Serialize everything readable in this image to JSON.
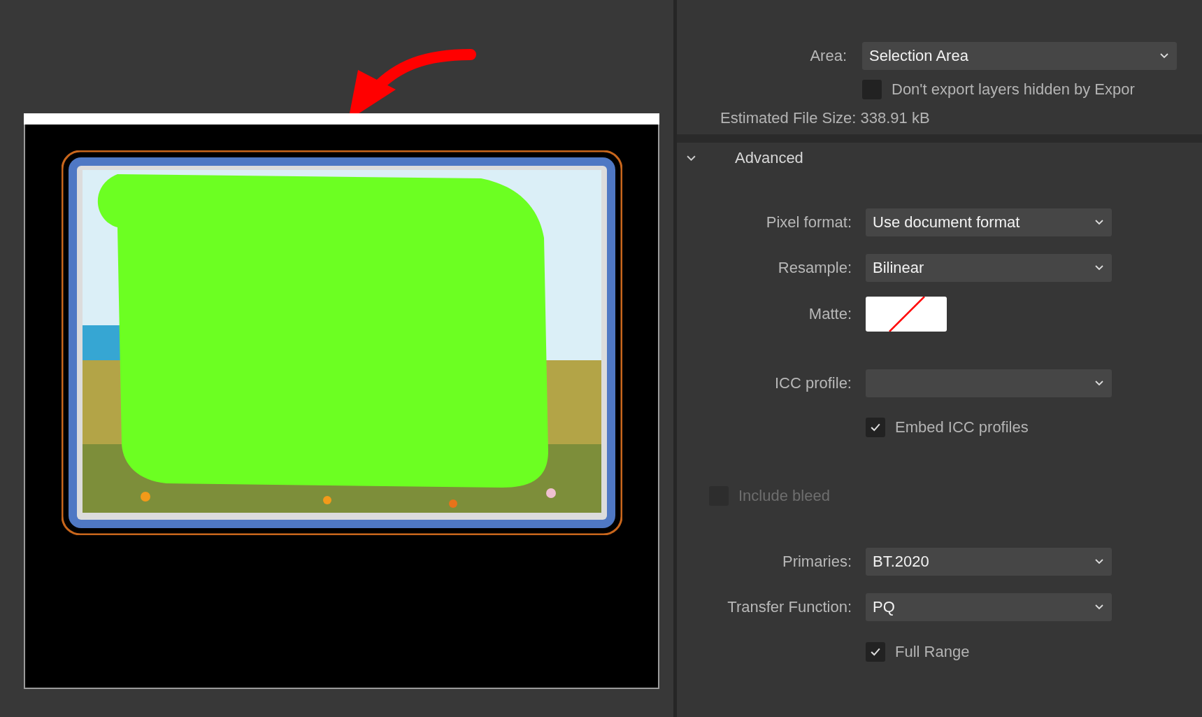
{
  "area": {
    "label": "Area:",
    "value": "Selection Area"
  },
  "hidden_layers": {
    "label": "Don't export layers hidden by Expor",
    "checked": false
  },
  "estimated_size": "Estimated File Size: 338.91 kB",
  "advanced": {
    "title": "Advanced",
    "expanded": true,
    "fields": [
      {
        "kind": "dropdown",
        "label": "Pixel format:",
        "value": "Use document format"
      },
      {
        "kind": "dropdown",
        "label": "Resample:",
        "value": "Bilinear"
      },
      {
        "kind": "swatch",
        "label": "Matte:"
      },
      {
        "kind": "dropdown",
        "label": "ICC profile:"
      },
      {
        "kind": "checkbox",
        "label": "Embed ICC profiles",
        "checked": true,
        "disabled": false
      },
      {
        "kind": "checkbox",
        "label": "Include bleed",
        "checked": false,
        "disabled": true
      },
      {
        "kind": "dropdown",
        "label": "Primaries:",
        "value": "BT.2020"
      },
      {
        "kind": "dropdown",
        "label": "Transfer Function:",
        "value": "PQ"
      },
      {
        "kind": "checkbox",
        "label": "Full Range",
        "checked": true,
        "disabled": false
      }
    ]
  }
}
